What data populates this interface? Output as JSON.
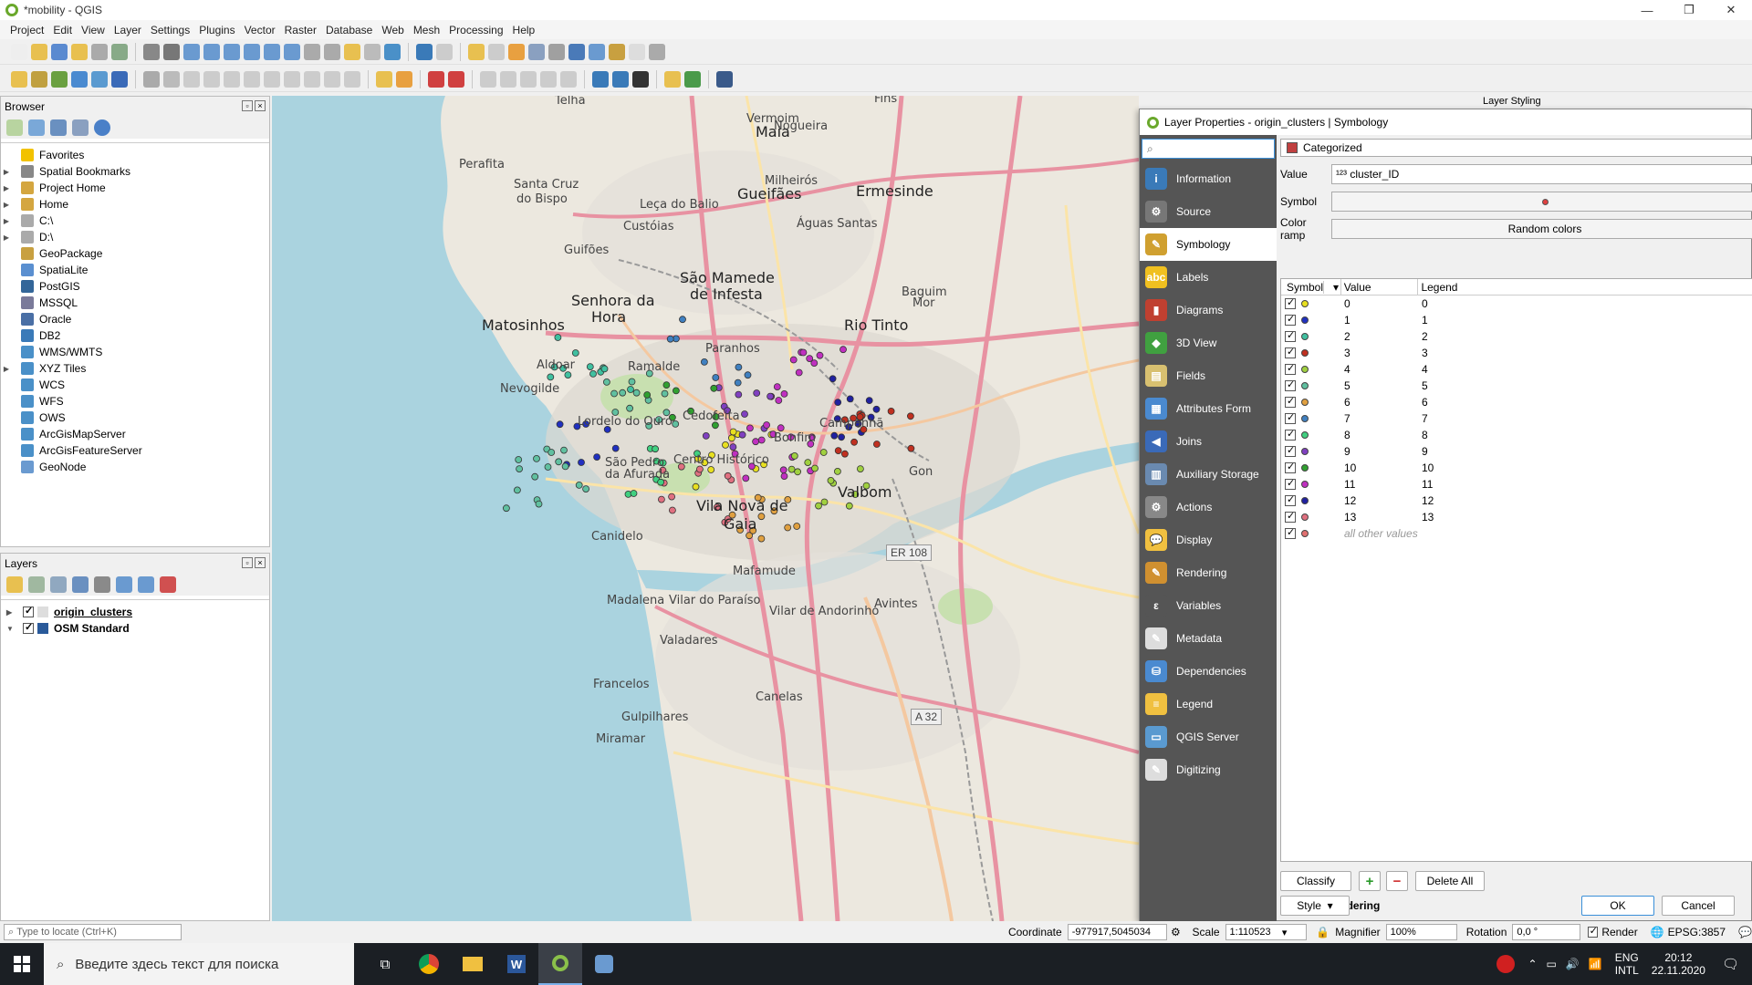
{
  "window": {
    "title": "*mobility - QGIS"
  },
  "menu": [
    "Project",
    "Edit",
    "View",
    "Layer",
    "Settings",
    "Plugins",
    "Vector",
    "Raster",
    "Database",
    "Web",
    "Mesh",
    "Processing",
    "Help"
  ],
  "browser": {
    "title": "Browser",
    "items": [
      {
        "label": "Favorites",
        "expandable": false,
        "color": "#f2c200"
      },
      {
        "label": "Spatial Bookmarks",
        "expandable": true,
        "color": "#888"
      },
      {
        "label": "Project Home",
        "expandable": true,
        "color": "#d4a640"
      },
      {
        "label": "Home",
        "expandable": true,
        "color": "#d4a640"
      },
      {
        "label": "C:\\",
        "expandable": true,
        "color": "#aaa"
      },
      {
        "label": "D:\\",
        "expandable": true,
        "color": "#aaa"
      },
      {
        "label": "GeoPackage",
        "expandable": false,
        "color": "#c8a040"
      },
      {
        "label": "SpatiaLite",
        "expandable": false,
        "color": "#5a8fd0"
      },
      {
        "label": "PostGIS",
        "expandable": false,
        "color": "#336699"
      },
      {
        "label": "MSSQL",
        "expandable": false,
        "color": "#7a7a9a"
      },
      {
        "label": "Oracle",
        "expandable": false,
        "color": "#4a6fa5"
      },
      {
        "label": "DB2",
        "expandable": false,
        "color": "#3a7ab8"
      },
      {
        "label": "WMS/WMTS",
        "expandable": false,
        "color": "#4a90c8"
      },
      {
        "label": "XYZ Tiles",
        "expandable": true,
        "color": "#4a90c8"
      },
      {
        "label": "WCS",
        "expandable": false,
        "color": "#4a90c8"
      },
      {
        "label": "WFS",
        "expandable": false,
        "color": "#4a90c8"
      },
      {
        "label": "OWS",
        "expandable": false,
        "color": "#4a90c8"
      },
      {
        "label": "ArcGisMapServer",
        "expandable": false,
        "color": "#4a90c8"
      },
      {
        "label": "ArcGisFeatureServer",
        "expandable": false,
        "color": "#4a90c8"
      },
      {
        "label": "GeoNode",
        "expandable": false,
        "color": "#6a9ad0"
      }
    ]
  },
  "layers": {
    "title": "Layers",
    "items": [
      {
        "label": "origin_clusters",
        "checked": true,
        "underline": true
      },
      {
        "label": "OSM Standard",
        "checked": true,
        "underline": false
      }
    ]
  },
  "map": {
    "labels_big": [
      {
        "text": "Maia"
      },
      {
        "text": "Ermesinde"
      },
      {
        "text": "São Mamede"
      },
      {
        "text": "de Infesta"
      },
      {
        "text": "Senhora da"
      },
      {
        "text": "Hora"
      },
      {
        "text": "Matosinhos"
      },
      {
        "text": "Rio Tinto"
      },
      {
        "text": "Valbom"
      },
      {
        "text": "Vila Nova de"
      },
      {
        "text": "Gaia"
      },
      {
        "text": "Gueifães"
      }
    ],
    "labels_med": [
      {
        "text": "Vermoim"
      },
      {
        "text": "Nogueira"
      },
      {
        "text": "Milheirós"
      },
      {
        "text": "Perafita"
      },
      {
        "text": "Santa Cruz"
      },
      {
        "text": "do Bispo"
      },
      {
        "text": "Leça do Balio"
      },
      {
        "text": "Custóias"
      },
      {
        "text": "Águas Santas"
      },
      {
        "text": "Guifões"
      },
      {
        "text": "Paranhos"
      },
      {
        "text": "Ramalde"
      },
      {
        "text": "Aldoar"
      },
      {
        "text": "Nevogilde"
      },
      {
        "text": "Lordelo do Ouro"
      },
      {
        "text": "Campanhã"
      },
      {
        "text": "Bonfim"
      },
      {
        "text": "Cedofeita"
      },
      {
        "text": "Centro Histórico"
      },
      {
        "text": "São Pedro"
      },
      {
        "text": "da Afurada"
      },
      {
        "text": "Canidelo"
      },
      {
        "text": "Mafamude"
      },
      {
        "text": "Madalena"
      },
      {
        "text": "Vilar do Paraíso"
      },
      {
        "text": "Vilar de Andorinho"
      },
      {
        "text": "Avintes"
      },
      {
        "text": "Valadares"
      },
      {
        "text": "Canelas"
      },
      {
        "text": "Francelos"
      },
      {
        "text": "Gulpilhares"
      },
      {
        "text": "Miramar"
      },
      {
        "text": "Baguim"
      },
      {
        "text": "Telha"
      },
      {
        "text": "Fins"
      },
      {
        "text": "Gon"
      },
      {
        "text": "Mor"
      }
    ],
    "shields": [
      "ER 108",
      "A 32"
    ]
  },
  "dock": {
    "title": "Layer Styling"
  },
  "dialog": {
    "title": "Layer Properties - origin_clusters | Symbology",
    "search_placeholder": "",
    "nav": [
      {
        "label": "Information",
        "color": "#3a7ab8",
        "glyph": "i"
      },
      {
        "label": "Source",
        "color": "#777",
        "glyph": "⚙"
      },
      {
        "label": "Symbology",
        "color": "#d0a030",
        "glyph": "✎",
        "active": true
      },
      {
        "label": "Labels",
        "color": "#f0c020",
        "glyph": "abc"
      },
      {
        "label": "Diagrams",
        "color": "#c04030",
        "glyph": "▮"
      },
      {
        "label": "3D View",
        "color": "#40a040",
        "glyph": "◆"
      },
      {
        "label": "Fields",
        "color": "#d8c070",
        "glyph": "▤"
      },
      {
        "label": "Attributes Form",
        "color": "#4a8ad0",
        "glyph": "▦"
      },
      {
        "label": "Joins",
        "color": "#3a6ab8",
        "glyph": "◀"
      },
      {
        "label": "Auxiliary Storage",
        "color": "#6a8ab0",
        "glyph": "▥"
      },
      {
        "label": "Actions",
        "color": "#888",
        "glyph": "⚙"
      },
      {
        "label": "Display",
        "color": "#f0c040",
        "glyph": "💬"
      },
      {
        "label": "Rendering",
        "color": "#d09030",
        "glyph": "✎"
      },
      {
        "label": "Variables",
        "color": "#555",
        "glyph": "ε"
      },
      {
        "label": "Metadata",
        "color": "#ddd",
        "glyph": "✎"
      },
      {
        "label": "Dependencies",
        "color": "#4a8ad0",
        "glyph": "⛁"
      },
      {
        "label": "Legend",
        "color": "#f0c040",
        "glyph": "≡"
      },
      {
        "label": "QGIS Server",
        "color": "#5a9ad0",
        "glyph": "▭"
      },
      {
        "label": "Digitizing",
        "color": "#ddd",
        "glyph": "✎"
      }
    ],
    "renderer": "Categorized",
    "value_label": "Value",
    "value_field": "¹²³ cluster_ID",
    "symbol_label": "Symbol",
    "color_ramp_label": "Color ramp",
    "color_ramp": "Random colors",
    "table_headers": [
      "Symbol",
      "Value",
      "Legend"
    ],
    "categories": [
      {
        "value": "0",
        "legend": "0",
        "color": "#e8e020"
      },
      {
        "value": "1",
        "legend": "1",
        "color": "#2030c0"
      },
      {
        "value": "2",
        "legend": "2",
        "color": "#40c0a0"
      },
      {
        "value": "3",
        "legend": "3",
        "color": "#c03020"
      },
      {
        "value": "4",
        "legend": "4",
        "color": "#a0d040"
      },
      {
        "value": "5",
        "legend": "5",
        "color": "#60c0a0"
      },
      {
        "value": "6",
        "legend": "6",
        "color": "#e0a040"
      },
      {
        "value": "7",
        "legend": "7",
        "color": "#4080c0"
      },
      {
        "value": "8",
        "legend": "8",
        "color": "#40d080"
      },
      {
        "value": "9",
        "legend": "9",
        "color": "#8040c0"
      },
      {
        "value": "10",
        "legend": "10",
        "color": "#30a030"
      },
      {
        "value": "11",
        "legend": "11",
        "color": "#c030c0"
      },
      {
        "value": "12",
        "legend": "12",
        "color": "#2020a0"
      },
      {
        "value": "13",
        "legend": "13",
        "color": "#e07080"
      }
    ],
    "other_values": "all other values",
    "other_color": "#e07070",
    "buttons": {
      "classify": "Classify",
      "add": "+",
      "remove": "−",
      "delete_all": "Delete All",
      "layer_rendering": "Layer Rendering",
      "style": "Style",
      "ok": "OK",
      "cancel": "Cancel"
    }
  },
  "statusbar": {
    "locate_placeholder": "Type to locate (Ctrl+K)",
    "coordinate_label": "Coordinate",
    "coordinate": "-977917,5045034",
    "scale_label": "Scale",
    "scale": "1:110523",
    "magnifier_label": "Magnifier",
    "magnifier": "100%",
    "rotation_label": "Rotation",
    "rotation": "0,0 °",
    "render_label": "Render",
    "crs": "EPSG:3857"
  },
  "taskbar": {
    "search_placeholder": "Введите здесь текст для поиска",
    "lang1": "ENG",
    "lang2": "INTL",
    "time": "20:12",
    "date": "22.11.2020"
  }
}
